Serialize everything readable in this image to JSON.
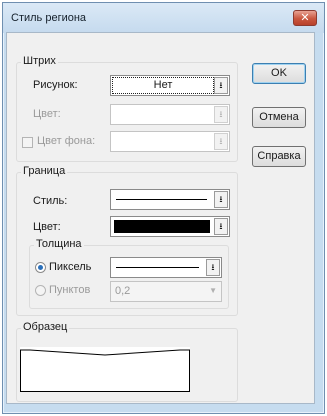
{
  "window": {
    "title": "Стиль региона",
    "close_glyph": "✕"
  },
  "stroke": {
    "group_label": "Штрих",
    "pattern_label": "Рисунок:",
    "pattern_value": "Нет",
    "color_label": "Цвет:",
    "bgcolor_label": "Цвет фона:"
  },
  "border": {
    "group_label": "Граница",
    "style_label": "Стиль:",
    "color_label": "Цвет:",
    "color_value": "#000000",
    "thickness": {
      "group_label": "Толщина",
      "pixels_label": "Пиксель",
      "points_label": "Пунктов",
      "points_value": "0,2",
      "selected": "pixels"
    }
  },
  "sample": {
    "group_label": "Образец"
  },
  "buttons": {
    "ok": "OK",
    "cancel": "Отмена",
    "help": "Справка"
  },
  "icons": {
    "dropdown_arrow": "⭳",
    "spin_arrow": "▼"
  }
}
